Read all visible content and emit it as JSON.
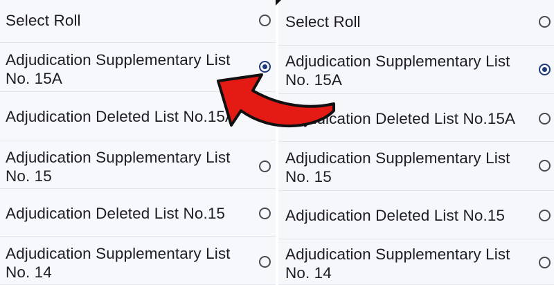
{
  "panels": [
    {
      "id": "left",
      "rows": [
        {
          "label": "Select Roll",
          "selected": false
        },
        {
          "label": "Adjudication Supplementary List No. 15A",
          "selected": true
        },
        {
          "label": "Adjudication Deleted List No.15A",
          "selected": false,
          "radio_hidden": true
        },
        {
          "label": "Adjudication Supplementary List No. 15",
          "selected": false
        },
        {
          "label": "Adjudication Deleted List No.15",
          "selected": false
        },
        {
          "label": "Adjudication Supplementary List No. 14",
          "selected": false
        }
      ]
    },
    {
      "id": "right",
      "rows": [
        {
          "label": "Select Roll",
          "selected": false
        },
        {
          "label": "Adjudication Supplementary List No. 15A",
          "selected": true
        },
        {
          "label": "Adjudication Deleted List No.15A",
          "selected": false
        },
        {
          "label": "Adjudication Supplementary List No. 15",
          "selected": false
        },
        {
          "label": "Adjudication Deleted List No.15",
          "selected": false
        },
        {
          "label": "Adjudication Supplementary List No. 14",
          "selected": false
        }
      ]
    }
  ],
  "colors": {
    "arrow_fill": "#e31b14",
    "arrow_outline": "#111111",
    "radio_selected": "#1f3a7a",
    "row_background": "#f7f8fc"
  },
  "icons": {
    "radio": "radio-button",
    "annotation": "curved-arrow-icon"
  }
}
